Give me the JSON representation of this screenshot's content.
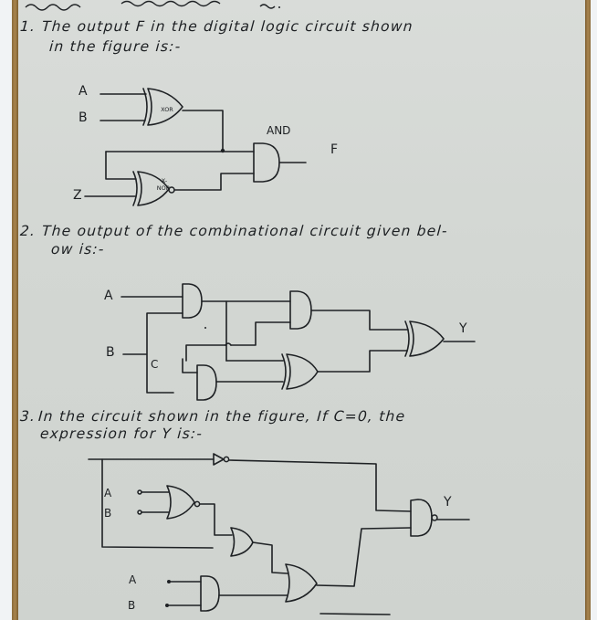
{
  "document": {
    "type": "handwritten notebook page",
    "top_scribble": "~~~~ ~~~~~~ ~."
  },
  "questions": [
    {
      "number": "1.",
      "line1": "The output F in the digital logic circuit shown",
      "line2": "in the figure is:-",
      "circuit": {
        "inputs": [
          "A",
          "B",
          "Z"
        ],
        "gates": [
          {
            "type": "XOR",
            "label": "XOR"
          },
          {
            "type": "XNOR",
            "label_top": "X-",
            "label_bottom": "NOR"
          },
          {
            "type": "AND",
            "label": "AND"
          }
        ],
        "output": "F"
      }
    },
    {
      "number": "2.",
      "line1": "The output of the combinational circuit given bel-",
      "line2": "ow is:-",
      "circuit": {
        "inputs": [
          "A",
          "B",
          "C"
        ],
        "gates": [
          "AND",
          "AND",
          "AND",
          "XOR",
          "XOR"
        ],
        "output": "Y"
      }
    },
    {
      "number": "3.",
      "line1": "In the circuit shown in the figure, If C=0, the",
      "line2": "expression for Y is:-",
      "circuit": {
        "inputs": [
          "A",
          "B",
          "A",
          "B"
        ],
        "gates": [
          "NOT",
          "NOR",
          "OR",
          "AND",
          "OR",
          "NAND"
        ],
        "output": "Y"
      }
    }
  ]
}
